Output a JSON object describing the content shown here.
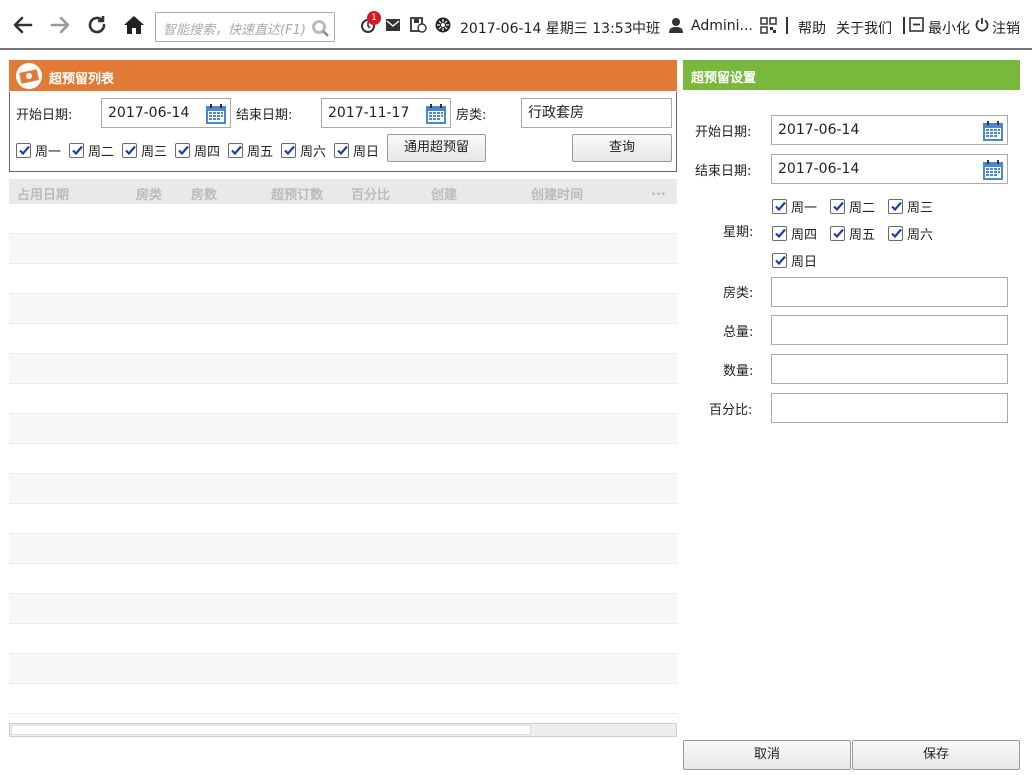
{
  "toolbar": {
    "search_placeholder": "智能搜索，快速直达(F1)",
    "badge_count": "1",
    "datetime": "2017-06-14 星期三 13:53",
    "shift": "中班",
    "user": "Admini...",
    "help": "帮助",
    "about": "关于我们",
    "minimize": "最小化",
    "logout": "注销"
  },
  "left": {
    "title": "超预留列表",
    "start_label": "开始日期:",
    "start_value": "2017-06-14",
    "end_label": "结束日期:",
    "end_value": "2017-11-17",
    "roomtype_label": "房类:",
    "roomtype_value": "行政套房",
    "days": [
      "周一",
      "周二",
      "周三",
      "周四",
      "周五",
      "周六",
      "周日"
    ],
    "general_button": "通用超预留",
    "query_button": "查询",
    "columns": [
      "占用日期",
      "房类",
      "房数",
      "超预订数",
      "百分比",
      "创建",
      "创建时间",
      "..."
    ]
  },
  "right": {
    "title": "超预留设置",
    "start_label": "开始日期:",
    "start_value": "2017-06-14",
    "end_label": "结束日期:",
    "end_value": "2017-06-14",
    "week_label": "星期:",
    "days": [
      "周一",
      "周二",
      "周三",
      "周四",
      "周五",
      "周六",
      "周日"
    ],
    "roomtype_label": "房类:",
    "total_label": "总量:",
    "count_label": "数量:",
    "percent_label": "百分比:",
    "cancel_button": "取消",
    "save_button": "保存"
  },
  "colors": {
    "left_header": "#e07a35",
    "right_header": "#78b83a"
  }
}
